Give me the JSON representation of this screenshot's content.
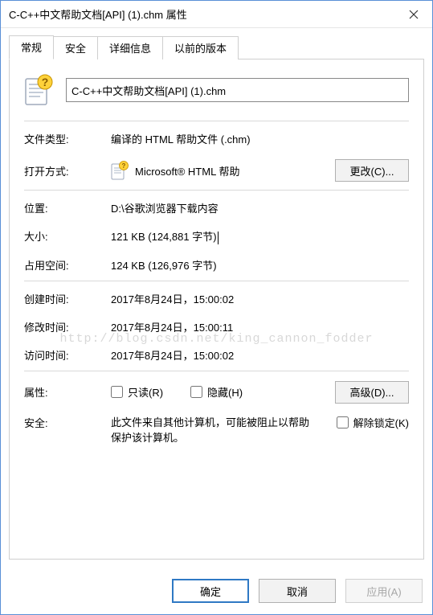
{
  "titlebar": {
    "title": "C-C++中文帮助文档[API] (1).chm 属性"
  },
  "tabs": [
    {
      "label": "常规",
      "active": true
    },
    {
      "label": "安全",
      "active": false
    },
    {
      "label": "详细信息",
      "active": false
    },
    {
      "label": "以前的版本",
      "active": false
    }
  ],
  "general": {
    "filename": "C-C++中文帮助文档[API] (1).chm",
    "filetype_label": "文件类型:",
    "filetype_value": "编译的 HTML 帮助文件 (.chm)",
    "openwith_label": "打开方式:",
    "openwith_value": "Microsoft® HTML 帮助",
    "change_button": "更改(C)...",
    "location_label": "位置:",
    "location_value": "D:\\谷歌浏览器下载内容",
    "size_label": "大小:",
    "size_value": "121 KB (124,881 字节)",
    "sizeondisk_label": "占用空间:",
    "sizeondisk_value": "124 KB (126,976 字节)",
    "created_label": "创建时间:",
    "created_value": "2017年8月24日，15:00:02",
    "modified_label": "修改时间:",
    "modified_value": "2017年8月24日，15:00:11",
    "accessed_label": "访问时间:",
    "accessed_value": "2017年8月24日，15:00:02",
    "attributes_label": "属性:",
    "readonly_label": "只读(R)",
    "hidden_label": "隐藏(H)",
    "advanced_button": "高级(D)...",
    "security_label": "安全:",
    "security_text": "此文件来自其他计算机，可能被阻止以帮助保护该计算机。",
    "unblock_label": "解除锁定(K)"
  },
  "buttons": {
    "ok": "确定",
    "cancel": "取消",
    "apply": "应用(A)"
  },
  "watermark": "http://blog.csdn.net/king_cannon_fodder",
  "icons": {
    "chm": "chm-help-icon",
    "close": "close-icon"
  }
}
